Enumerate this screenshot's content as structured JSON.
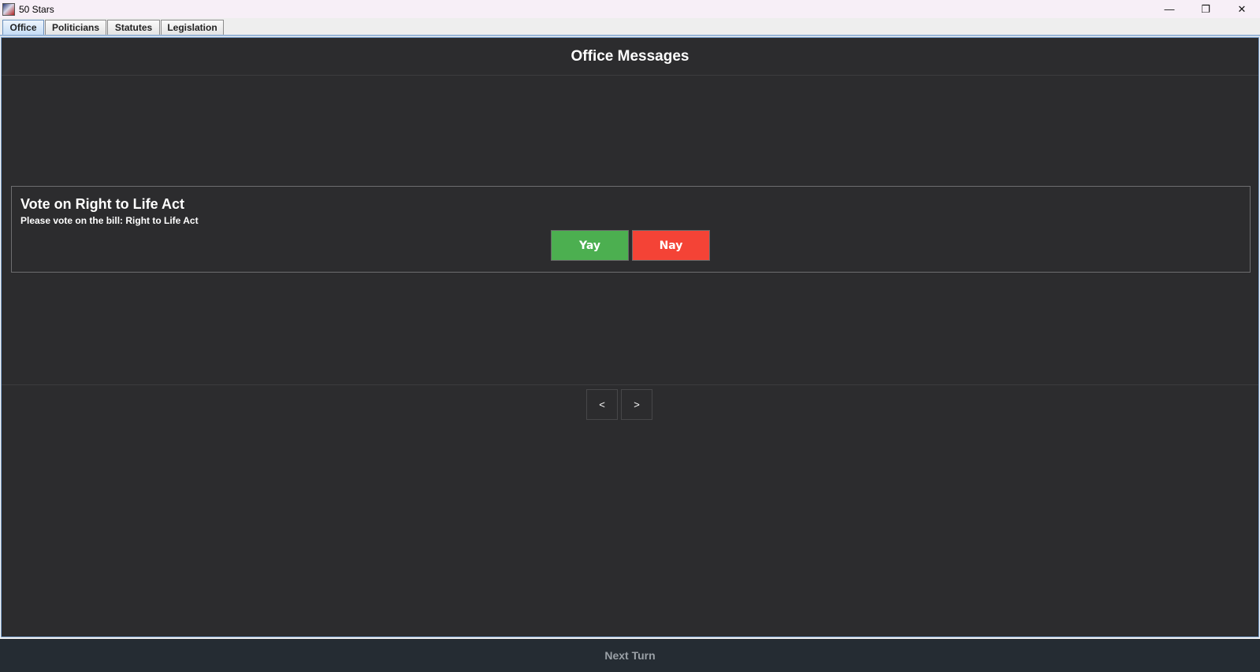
{
  "window": {
    "title": "50 Stars",
    "minimize_glyph": "—",
    "maximize_glyph": "❐",
    "close_glyph": "✕"
  },
  "tabs": [
    {
      "label": "Office",
      "active": true
    },
    {
      "label": "Politicians",
      "active": false
    },
    {
      "label": "Statutes",
      "active": false
    },
    {
      "label": "Legislation",
      "active": false
    }
  ],
  "office": {
    "header": "Office Messages",
    "message": {
      "title": "Vote on Right to Life Act",
      "body": "Please vote on the bill: Right to Life Act",
      "yay_label": "Yay",
      "nay_label": "Nay"
    },
    "pagination": {
      "prev_label": "<",
      "next_label": ">"
    }
  },
  "footer": {
    "next_turn_label": "Next Turn"
  },
  "colors": {
    "content_bg": "#2c2c2e",
    "yay": "#4caf50",
    "nay": "#f44336",
    "footer_bg": "#252c33"
  }
}
